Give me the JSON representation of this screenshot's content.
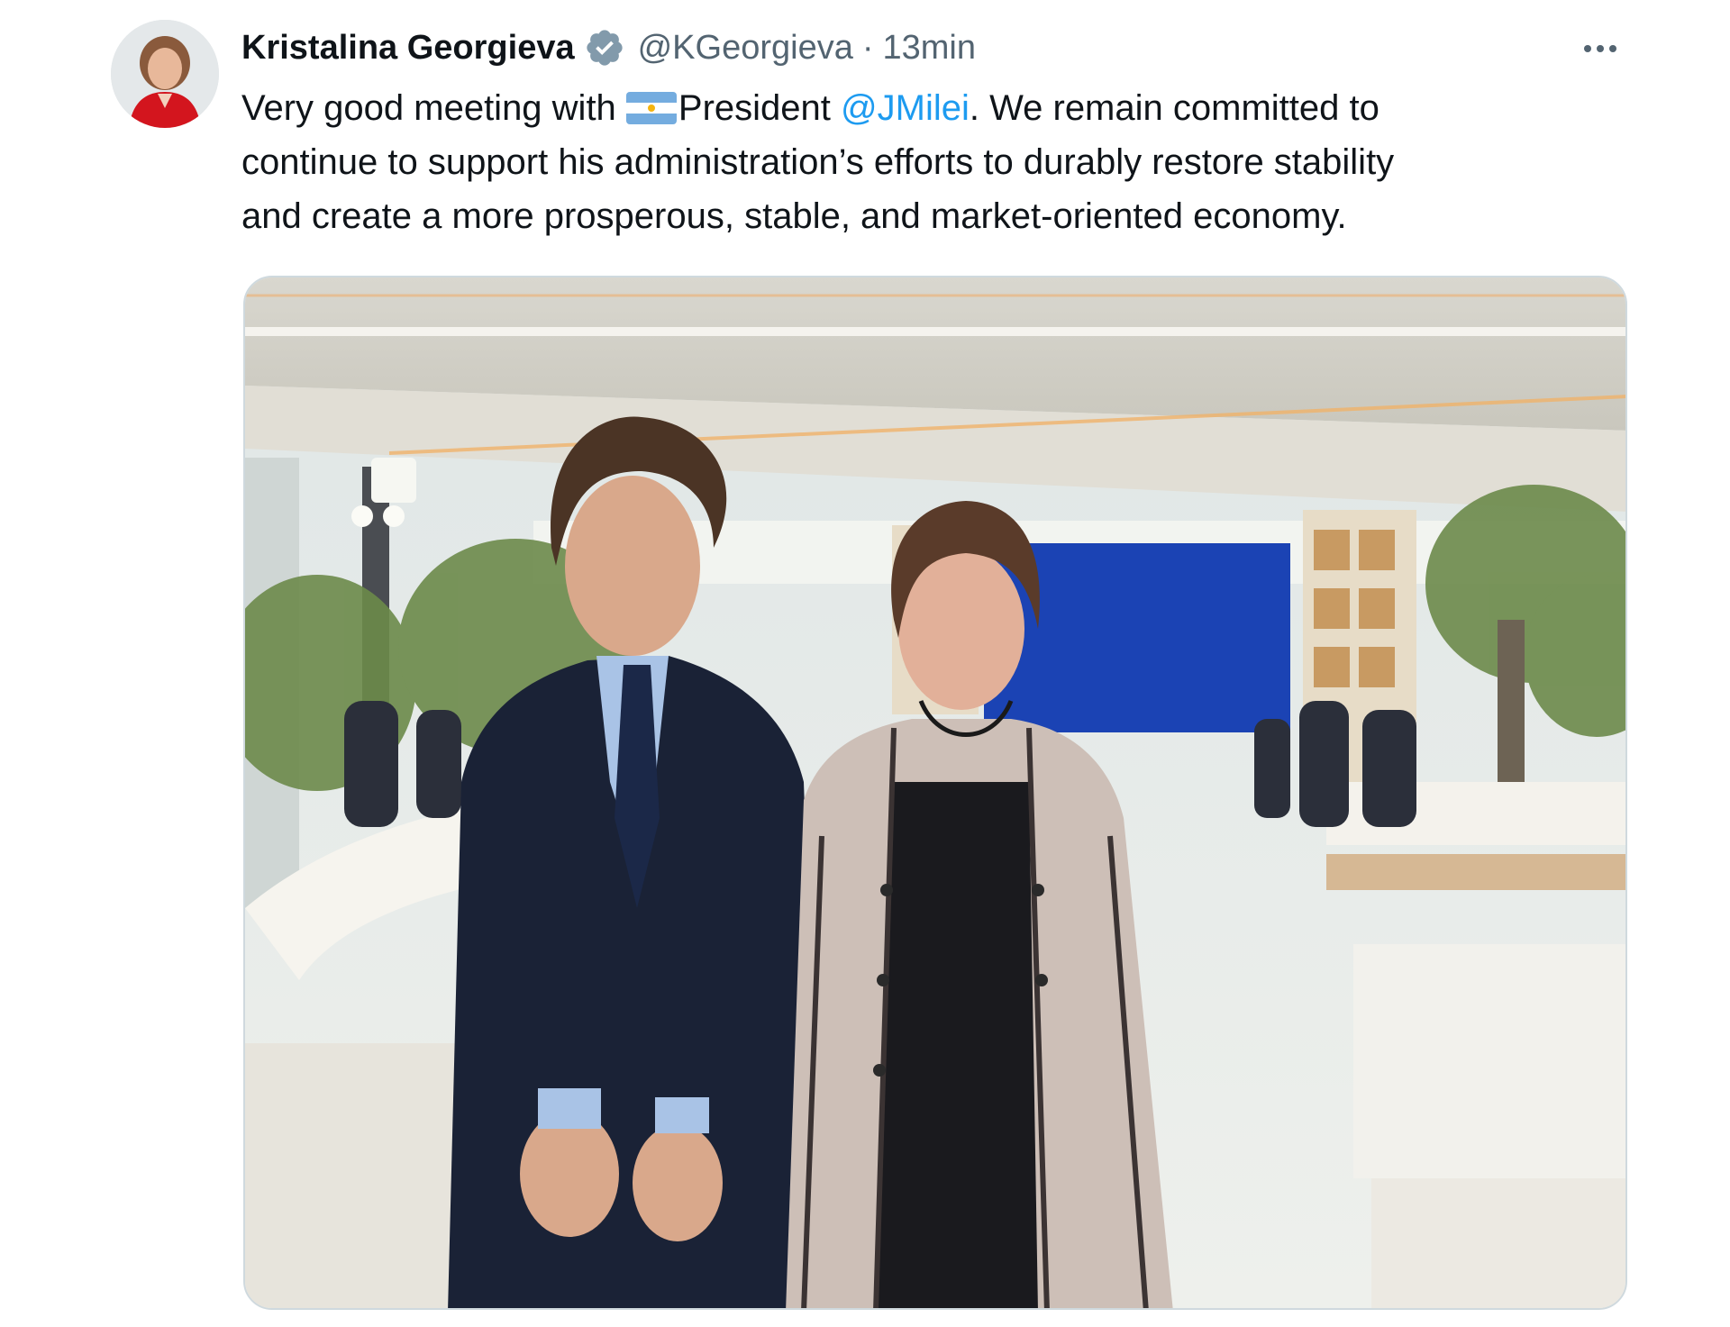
{
  "tweet": {
    "author": {
      "display_name": "Kristalina Georgieva",
      "verified": true,
      "handle": "@KGeorgieva",
      "avatar_icon": "profile-photo-avatar"
    },
    "separator": "·",
    "timestamp": "13min",
    "text": {
      "line1_prefix": "Very good meeting with ",
      "flag_icon": "argentina-flag-emoji",
      "line1_president": "President ",
      "mention": "@JMilei",
      "line1_suffix": ". We remain committed to",
      "line2": "continue to support his administration’s efforts to durably restore stability",
      "line3": "and create a more prosperous, stable, and market-oriented economy."
    },
    "media": {
      "type": "photo",
      "description_icon": "meeting-photo"
    },
    "menu_icon": "more-options-icon"
  },
  "colors": {
    "link": "#1d9bf0",
    "secondary_text": "#536471",
    "verified_badge": "#829aab",
    "flag_blue": "#74acdf",
    "flag_sun": "#f6b40e"
  }
}
